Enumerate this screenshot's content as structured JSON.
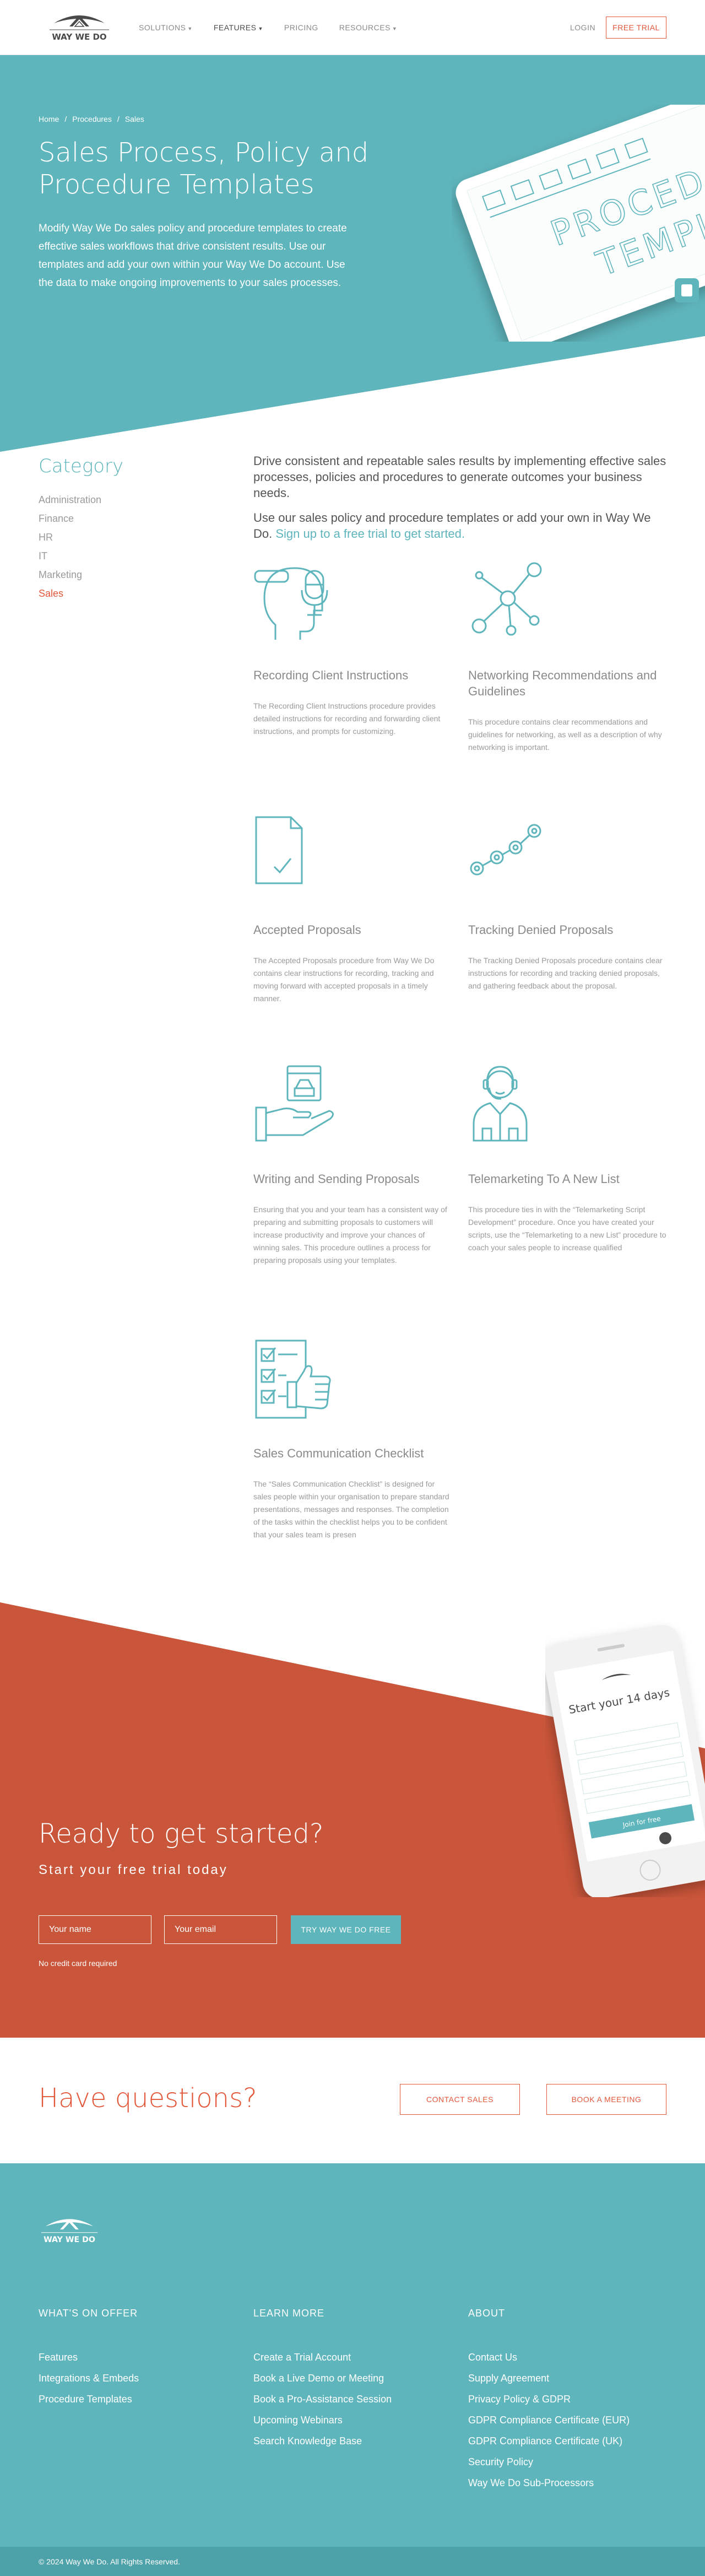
{
  "colors": {
    "teal": "#5fb5bc",
    "red": "#c9553a",
    "accent": "#e2573a"
  },
  "nav": {
    "logo_text": "WAY WE DO",
    "items": [
      {
        "label": "SOLUTIONS",
        "caret": true
      },
      {
        "label": "FEATURES",
        "caret": true
      },
      {
        "label": "PRICING",
        "caret": false
      },
      {
        "label": "RESOURCES",
        "caret": true
      }
    ],
    "login": "LOGIN",
    "trial": "FREE TRIAL"
  },
  "hero": {
    "breadcrumb": [
      "Home",
      "/",
      "Procedures",
      "/",
      "Sales"
    ],
    "title": "Sales Process, Policy and Procedure Templates",
    "description": "Modify Way We Do sales policy and procedure templates to create effective sales workflows that drive consistent results. Use our templates and add your own within your Way We Do account. Use the data to make ongoing improvements to your sales processes.",
    "tablet_text": [
      "PROCED",
      "TEMPL"
    ]
  },
  "sidebar": {
    "title": "Category",
    "items": [
      "Administration",
      "Finance",
      "HR",
      "IT",
      "Marketing",
      "Sales"
    ],
    "active": "Sales"
  },
  "intro": {
    "p1": "Drive consistent and repeatable sales results by implementing effective sales processes, policies and procedures to generate outcomes your business needs.",
    "p2": "Use our sales policy and procedure templates or add your own in Way We Do.",
    "p2_link": "Sign up to a free trial to get started."
  },
  "cards": [
    {
      "icon": "headset-head-icon",
      "title": "Recording Client Instructions",
      "text": "The Recording Client Instructions procedure provides detailed instructions for recording and forwarding client instructions, and prompts for customizing."
    },
    {
      "icon": "network-icon",
      "title": "Networking Recommendations and Guidelines",
      "text": "This procedure contains clear recommendations and guidelines for networking, as well as a description of why networking is important."
    },
    {
      "icon": "document-check-icon",
      "title": "Accepted Proposals",
      "text": "The Accepted Proposals procedure from Way We Do contains clear instructions for recording, tracking and moving forward with accepted proposals in a timely manner."
    },
    {
      "icon": "tracking-nodes-icon",
      "title": "Tracking Denied Proposals",
      "text": "The Tracking Denied Proposals procedure contains clear instructions for recording and tracking denied proposals, and gathering feedback about the proposal."
    },
    {
      "icon": "hand-proposal-icon",
      "title": "Writing and Sending Proposals",
      "text": "Ensuring that you and your team has a consistent way of preparing and submitting proposals to customers will increase productivity and improve your chances of winning sales. This procedure outlines a process for preparing proposals using your templates."
    },
    {
      "icon": "telemarketer-icon",
      "title": "Telemarketing To A New List",
      "text": "This procedure ties in with the “Telemarketing Script Development” procedure. Once you have created your scripts, use the “Telemarketing to a new List” procedure to coach your sales people to increase qualified"
    },
    {
      "icon": "checklist-thumbs-up-icon",
      "title": "Sales Communication Checklist",
      "text": "The “Sales Communication Checklist” is designed for sales people within your organisation to prepare standard presentations, messages and responses. The completion of the tasks within the checklist helps you to be confident that your sales team is presen"
    }
  ],
  "cta": {
    "title": "Ready to get started?",
    "subtitle": "Start your free trial today",
    "name_placeholder": "Your name",
    "email_placeholder": "Your email",
    "button": "TRY WAY WE DO FREE",
    "note": "No credit card required",
    "phone_heading": "Start your 14 days",
    "phone_button": "Join for free"
  },
  "questions": {
    "title": "Have questions?",
    "contact": "CONTACT SALES",
    "meeting": "BOOK A MEETING"
  },
  "footer": {
    "columns": [
      {
        "title": "WHAT'S ON OFFER",
        "links": [
          "Features",
          "Integrations & Embeds",
          "Procedure Templates"
        ]
      },
      {
        "title": "LEARN MORE",
        "links": [
          "Create a Trial Account",
          "Book a Live Demo or Meeting",
          "Book a Pro-Assistance Session",
          "Upcoming Webinars",
          "Search Knowledge Base"
        ]
      },
      {
        "title": "ABOUT",
        "links": [
          "Contact Us",
          "Supply Agreement",
          "Privacy Policy & GDPR",
          "GDPR Compliance Certificate (EUR)",
          "GDPR Compliance Certificate (UK)",
          "Security Policy",
          "Way We Do Sub-Processors"
        ]
      }
    ],
    "copyright": "© 2024 Way We Do. All Rights Reserved."
  }
}
